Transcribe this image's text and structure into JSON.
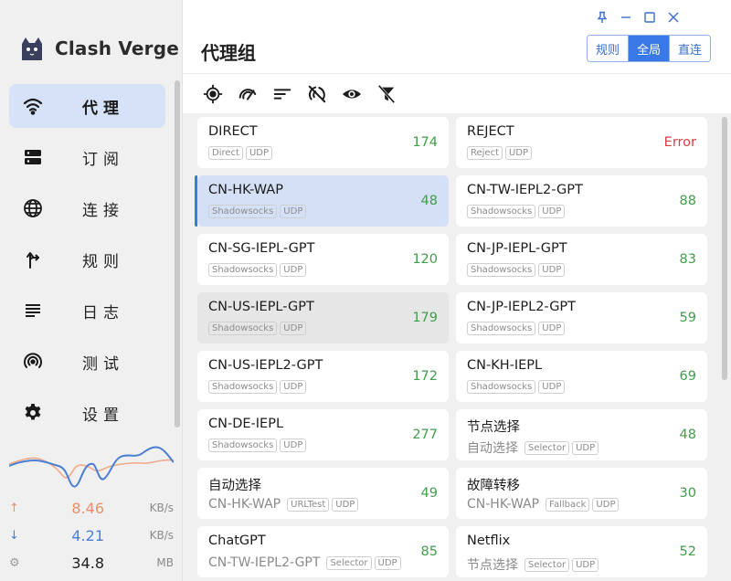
{
  "app": {
    "name": "Clash Verge"
  },
  "nav": [
    {
      "label": "代理",
      "icon": "wifi-icon",
      "active": true
    },
    {
      "label": "订阅",
      "icon": "server-icon",
      "active": false
    },
    {
      "label": "连接",
      "icon": "globe-icon",
      "active": false
    },
    {
      "label": "规则",
      "icon": "fork-arrow-icon",
      "active": false
    },
    {
      "label": "日志",
      "icon": "list-lines-icon",
      "active": false
    },
    {
      "label": "测试",
      "icon": "broadcast-icon",
      "active": false
    },
    {
      "label": "设置",
      "icon": "gear-icon",
      "active": false
    }
  ],
  "traffic": {
    "up": {
      "value": "8.46",
      "unit": "KB/s",
      "icon": "arrow-up-icon"
    },
    "down": {
      "value": "4.21",
      "unit": "KB/s",
      "icon": "arrow-down-icon"
    },
    "memory": {
      "value": "34.8",
      "unit": "MB",
      "icon": "memory-icon"
    }
  },
  "header": {
    "title": "代理组",
    "modes": [
      {
        "label": "规则",
        "active": false
      },
      {
        "label": "全局",
        "active": true
      },
      {
        "label": "直连",
        "active": false
      }
    ]
  },
  "toolbar": [
    "locate-icon",
    "speedometer-icon",
    "sort-icon",
    "wifi-off-icon",
    "eye-icon",
    "filter-off-icon"
  ],
  "colors": {
    "accent": "#3b78e7",
    "selected_bg": "#d4e0f5",
    "delay_ok": "#3f9e4a",
    "delay_error": "#d54040",
    "upload": "#e8906a",
    "download": "#4a7fd4"
  },
  "proxies": [
    {
      "name": "DIRECT",
      "now": "",
      "tags": [
        "Direct",
        "UDP"
      ],
      "delay": "174",
      "state": ""
    },
    {
      "name": "REJECT",
      "now": "",
      "tags": [
        "Reject",
        "UDP"
      ],
      "delay": "Error",
      "state": ""
    },
    {
      "name": "CN-HK-WAP",
      "now": "",
      "tags": [
        "Shadowsocks",
        "UDP"
      ],
      "delay": "48",
      "state": "selected"
    },
    {
      "name": "CN-TW-IEPL2-GPT",
      "now": "",
      "tags": [
        "Shadowsocks",
        "UDP"
      ],
      "delay": "88",
      "state": ""
    },
    {
      "name": "CN-SG-IEPL-GPT",
      "now": "",
      "tags": [
        "Shadowsocks",
        "UDP"
      ],
      "delay": "120",
      "state": ""
    },
    {
      "name": "CN-JP-IEPL-GPT",
      "now": "",
      "tags": [
        "Shadowsocks",
        "UDP"
      ],
      "delay": "83",
      "state": ""
    },
    {
      "name": "CN-US-IEPL-GPT",
      "now": "",
      "tags": [
        "Shadowsocks",
        "UDP"
      ],
      "delay": "179",
      "state": "hover"
    },
    {
      "name": "CN-JP-IEPL2-GPT",
      "now": "",
      "tags": [
        "Shadowsocks",
        "UDP"
      ],
      "delay": "59",
      "state": ""
    },
    {
      "name": "CN-US-IEPL2-GPT",
      "now": "",
      "tags": [
        "Shadowsocks",
        "UDP"
      ],
      "delay": "172",
      "state": ""
    },
    {
      "name": "CN-KH-IEPL",
      "now": "",
      "tags": [
        "Shadowsocks",
        "UDP"
      ],
      "delay": "69",
      "state": ""
    },
    {
      "name": "CN-DE-IEPL",
      "now": "",
      "tags": [
        "Shadowsocks",
        "UDP"
      ],
      "delay": "277",
      "state": ""
    },
    {
      "name": "节点选择",
      "now": "自动选择",
      "tags": [
        "Selector",
        "UDP"
      ],
      "delay": "48",
      "state": ""
    },
    {
      "name": "自动选择",
      "now": "CN-HK-WAP",
      "tags": [
        "URLTest",
        "UDP"
      ],
      "delay": "49",
      "state": ""
    },
    {
      "name": "故障转移",
      "now": "CN-HK-WAP",
      "tags": [
        "Fallback",
        "UDP"
      ],
      "delay": "30",
      "state": ""
    },
    {
      "name": "ChatGPT",
      "now": "CN-TW-IEPL2-GPT",
      "tags": [
        "Selector",
        "UDP"
      ],
      "delay": "85",
      "state": ""
    },
    {
      "name": "Netflix",
      "now": "节点选择",
      "tags": [
        "Selector",
        "UDP"
      ],
      "delay": "52",
      "state": ""
    }
  ]
}
